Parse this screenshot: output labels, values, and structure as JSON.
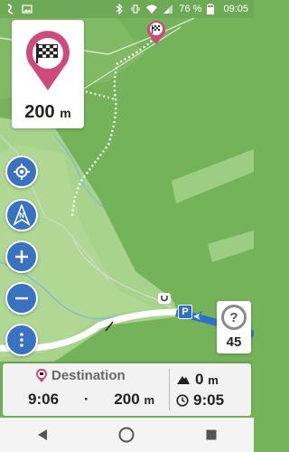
{
  "status_bar": {
    "battery_percent": "76 %",
    "time": "09:05"
  },
  "destination_card": {
    "distance_value": "200",
    "distance_unit": "m",
    "icon": "checkered-flag-pin-icon"
  },
  "left_controls": [
    {
      "name": "locate-button",
      "icon": "crosshair-icon"
    },
    {
      "name": "compass-button",
      "icon": "north-arrow-icon",
      "label": "N"
    },
    {
      "name": "zoom-in-button",
      "icon": "plus-icon"
    },
    {
      "name": "zoom-out-button",
      "icon": "minus-icon"
    },
    {
      "name": "more-button",
      "icon": "more-vertical-icon"
    }
  ],
  "map": {
    "parking_label": "P",
    "colors": {
      "forest": "#74b35a",
      "meadow": "#a8d38c",
      "road": "#ffffff",
      "main_road": "#2f6fc7",
      "route": "#ffffff",
      "pin": "#cf4a7c"
    }
  },
  "info_widget": {
    "symbol": "?",
    "value": "45"
  },
  "bottom_panel": {
    "destination_label": "Destination",
    "arrival_time": "9:06",
    "separator": "·",
    "remaining_distance": "200",
    "remaining_distance_unit": "m",
    "elevation_value": "0",
    "elevation_unit": "m",
    "duration": "9:05"
  },
  "nav_bar": {
    "back_icon": "back-triangle-icon",
    "home_icon": "home-circle-icon",
    "recents_icon": "recents-square-icon"
  }
}
